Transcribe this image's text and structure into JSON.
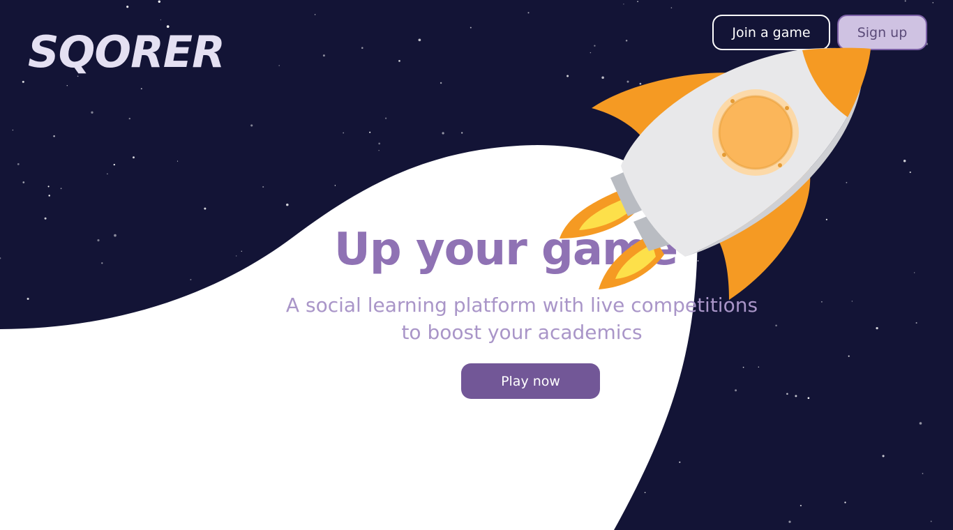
{
  "brand": {
    "logo_text": "SQORER"
  },
  "nav": {
    "join_label": "Join a game",
    "signup_label": "Sign up"
  },
  "hero": {
    "title": "Up your game",
    "subtitle_line1": "A social learning platform with live competitions",
    "subtitle_line2": "to boost your academics",
    "cta_label": "Play now"
  },
  "colors": {
    "space_background": "#131436",
    "hero_accent": "#8f72b4",
    "cta_background": "#725797",
    "signup_background": "#cfc2e2",
    "rocket_orange": "#f59a23"
  },
  "icons": {
    "illustration": "rocket-illustration",
    "stars": "star-field"
  }
}
